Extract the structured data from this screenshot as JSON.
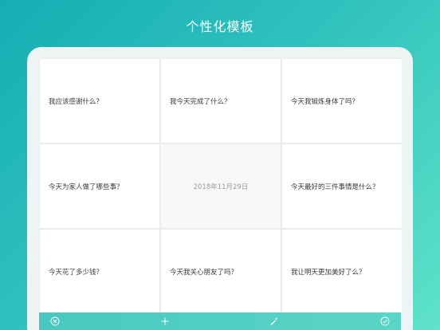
{
  "title": "个性化模板",
  "grid": {
    "cells": [
      "我应该感谢什么？",
      "我今天完成了什么？",
      "今天我锻炼身体了吗？",
      "今天为家人做了哪些事？",
      "2018年11月29日",
      "今天最好的三件事情是什么？",
      "今天花了多少钱？",
      "今天我关心朋友了吗？",
      "我让明天更加美好了么？"
    ]
  },
  "toolbar": {
    "icons": [
      "close-circle-icon",
      "plus-icon",
      "magic-wand-icon",
      "check-circle-icon"
    ]
  },
  "colors": {
    "gradient_start": "#16aeb4",
    "gradient_end": "#5fe3c9",
    "toolbar": "#49c8c0"
  }
}
